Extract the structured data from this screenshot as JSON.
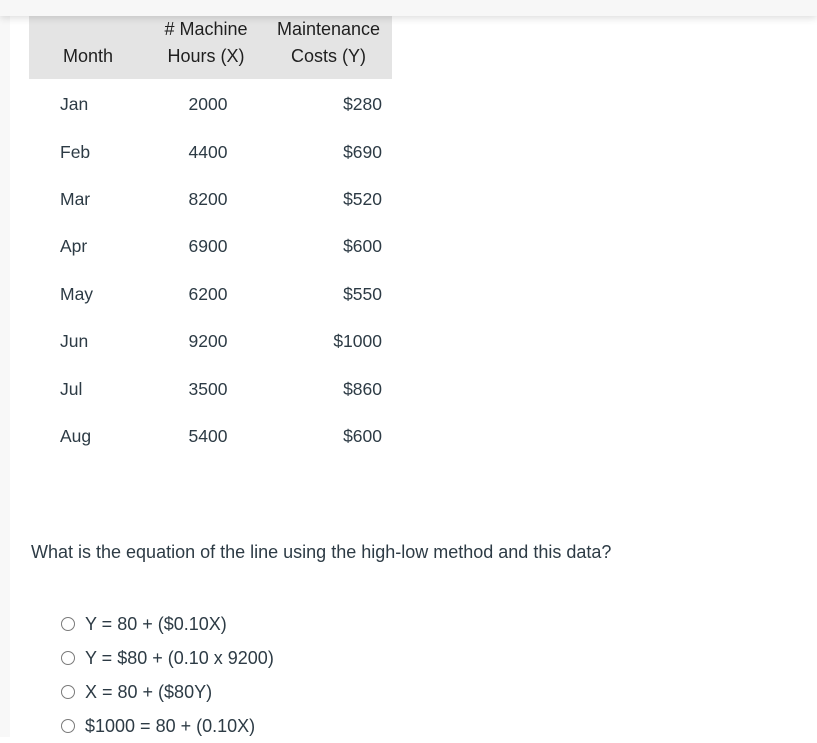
{
  "table": {
    "headers": {
      "month": [
        "",
        "Month"
      ],
      "hours": [
        "# Machine",
        "Hours (X)"
      ],
      "cost": [
        "Maintenance",
        "Costs (Y)"
      ]
    },
    "rows": [
      {
        "month": "Jan",
        "hours": "2000",
        "cost": "$280"
      },
      {
        "month": "Feb",
        "hours": "4400",
        "cost": "$690"
      },
      {
        "month": "Mar",
        "hours": "8200",
        "cost": "$520"
      },
      {
        "month": "Apr",
        "hours": "6900",
        "cost": "$600"
      },
      {
        "month": "May",
        "hours": "6200",
        "cost": "$550"
      },
      {
        "month": "Jun",
        "hours": "9200",
        "cost": "$1000"
      },
      {
        "month": "Jul",
        "hours": "3500",
        "cost": "$860"
      },
      {
        "month": "Aug",
        "hours": "5400",
        "cost": "$600"
      }
    ]
  },
  "question": "What is the equation of the line using the high-low method and this data?",
  "options": [
    {
      "label": "Y = 80 + ($0.10X)",
      "selected": false
    },
    {
      "label": "Y = $80 + (0.10 x 9200)",
      "selected": false
    },
    {
      "label": "X = 80 + ($80Y)",
      "selected": false
    },
    {
      "label": "$1000 = 80 + (0.10X)",
      "selected": false
    }
  ]
}
